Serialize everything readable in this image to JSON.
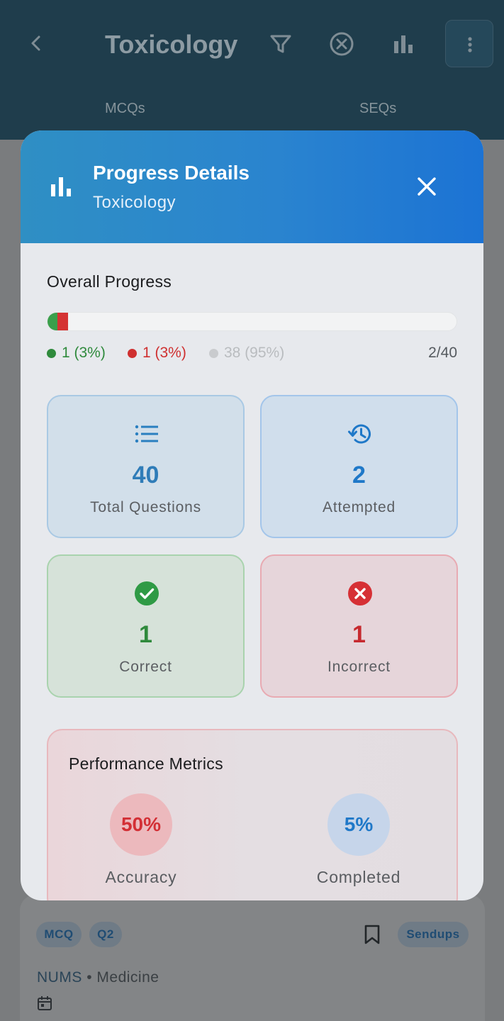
{
  "app": {
    "title": "Toxicology",
    "tabs": [
      "MCQs",
      "SEQs"
    ],
    "icons": [
      "back-icon",
      "filter-icon",
      "clear-filter-icon",
      "stats-icon",
      "more-icon"
    ]
  },
  "modal": {
    "title": "Progress Details",
    "subtitle": "Toxicology",
    "overall": {
      "label": "Overall Progress",
      "correct_fraction": 0.025,
      "incorrect_fraction": 0.025,
      "legend": {
        "correct": "1 (3%)",
        "incorrect": "1 (3%)",
        "unattempted": "38 (95%)"
      },
      "ratio": "2/40"
    },
    "stats": {
      "total": {
        "value": "40",
        "label": "Total Questions"
      },
      "attempted": {
        "value": "2",
        "label": "Attempted"
      },
      "correct": {
        "value": "1",
        "label": "Correct"
      },
      "incorrect": {
        "value": "1",
        "label": "Incorrect"
      }
    },
    "performance": {
      "title": "Performance Metrics",
      "accuracy": {
        "value": "50%",
        "label": "Accuracy"
      },
      "completed": {
        "value": "5%",
        "label": "Completed"
      }
    }
  },
  "card": {
    "chips": [
      "MCQ",
      "Q2"
    ],
    "tag": "Sendups",
    "source": "NUMS",
    "separator": "•",
    "subject": "Medicine"
  },
  "colors": {
    "correct": "#3a9f4b",
    "incorrect": "#d53333",
    "accent_blue": "#1f78c8",
    "header_gradient": [
      "#2f8fc4",
      "#1c73d4"
    ]
  }
}
